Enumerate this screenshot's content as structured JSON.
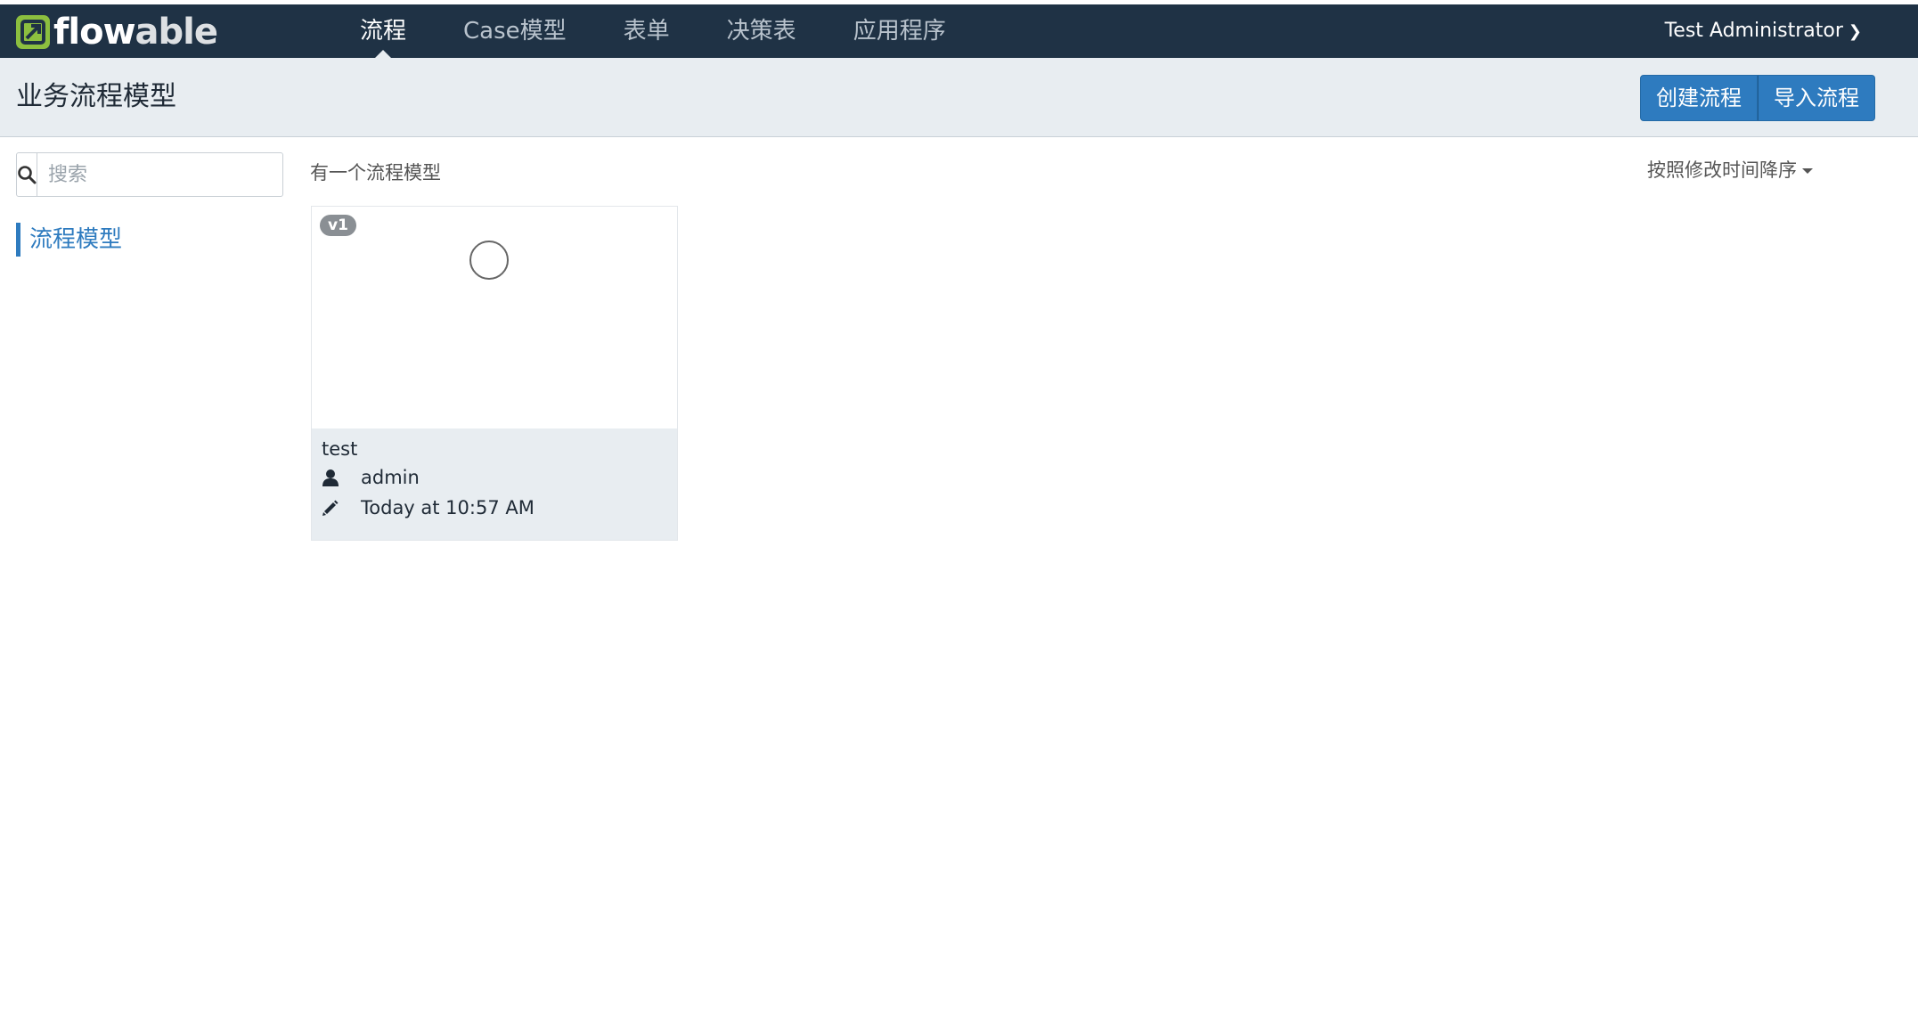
{
  "app": {
    "logo_text_flow": "flow",
    "logo_text_able": "able",
    "brand_color": "#8cbf3f"
  },
  "nav": {
    "items": [
      {
        "label": "流程",
        "active": true
      },
      {
        "label": "Case模型",
        "active": false
      },
      {
        "label": "表单",
        "active": false
      },
      {
        "label": "决策表",
        "active": false
      },
      {
        "label": "应用程序",
        "active": false
      }
    ],
    "user": "Test Administrator"
  },
  "subheader": {
    "title": "业务流程模型",
    "create_label": "创建流程",
    "import_label": "导入流程"
  },
  "sidebar": {
    "search_placeholder": "搜索",
    "filter_label": "流程模型"
  },
  "main": {
    "count_text": "有一个流程模型",
    "sort_label": "按照修改时间降序",
    "models": [
      {
        "version": "v1",
        "name": "test",
        "author": "admin",
        "modified": "Today at 10:57 AM"
      }
    ]
  },
  "colors": {
    "navbar": "#1f3245",
    "accent": "#2e7bbf",
    "subheader_bg": "#e8edf1"
  }
}
